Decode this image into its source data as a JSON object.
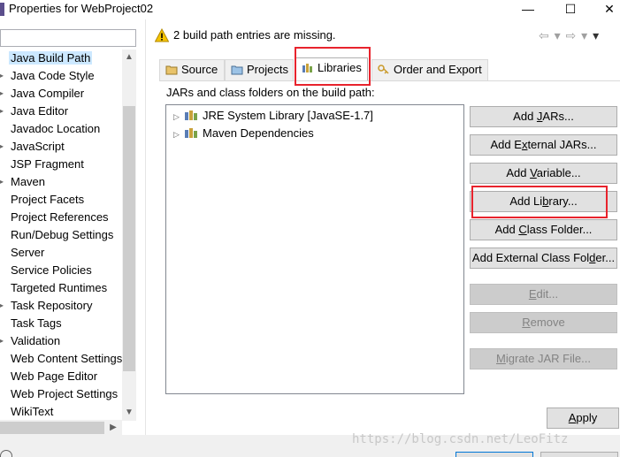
{
  "window": {
    "title": "Properties for WebProject02",
    "minimize_glyph": "—",
    "maximize_glyph": "☐",
    "close_glyph": "✕"
  },
  "left_panel": {
    "filter_placeholder": "",
    "items": [
      {
        "label": "Java Build Path",
        "selected": true
      },
      {
        "label": "Java Code Style",
        "expandable": true
      },
      {
        "label": "Java Compiler",
        "expandable": true
      },
      {
        "label": "Java Editor",
        "expandable": true
      },
      {
        "label": "Javadoc Location"
      },
      {
        "label": "JavaScript",
        "expandable": true
      },
      {
        "label": "JSP Fragment"
      },
      {
        "label": "Maven",
        "expandable": true
      },
      {
        "label": "Project Facets"
      },
      {
        "label": "Project References"
      },
      {
        "label": "Run/Debug Settings"
      },
      {
        "label": "Server"
      },
      {
        "label": "Service Policies"
      },
      {
        "label": "Targeted Runtimes"
      },
      {
        "label": "Task Repository",
        "expandable": true
      },
      {
        "label": "Task Tags"
      },
      {
        "label": "Validation",
        "expandable": true
      },
      {
        "label": "Web Content Settings"
      },
      {
        "label": "Web Page Editor"
      },
      {
        "label": "Web Project Settings"
      },
      {
        "label": "WikiText"
      }
    ]
  },
  "message": {
    "text": "2 build path entries are missing.",
    "icon": "warning-icon"
  },
  "tabs": [
    {
      "label": "Source",
      "icon": "source-folder-icon"
    },
    {
      "label": "Projects",
      "icon": "projects-icon"
    },
    {
      "label": "Libraries",
      "icon": "libraries-icon",
      "active": true
    },
    {
      "label": "Order and Export",
      "icon": "order-export-icon"
    }
  ],
  "libraries": {
    "label": "JARs and class folders on the build path:",
    "entries": [
      {
        "label": "JRE System Library [JavaSE-1.7]"
      },
      {
        "label": "Maven Dependencies"
      }
    ]
  },
  "buttons": {
    "add_jars": {
      "pre": "Add ",
      "u": "J",
      "post": "ARs..."
    },
    "add_external_jars": {
      "pre": "Add E",
      "u": "x",
      "post": "ternal JARs..."
    },
    "add_variable": {
      "pre": "Add ",
      "u": "V",
      "post": "ariable..."
    },
    "add_library": {
      "pre": "Add Li",
      "u": "b",
      "post": "rary..."
    },
    "add_class_folder": {
      "pre": "Add ",
      "u": "C",
      "post": "lass Folder..."
    },
    "add_external_class_folder": {
      "pre": "Add External Class Fol",
      "u": "d",
      "post": "er..."
    },
    "edit": {
      "pre": "",
      "u": "E",
      "post": "dit..."
    },
    "remove": {
      "pre": "",
      "u": "R",
      "post": "emove"
    },
    "migrate_jar": {
      "pre": "",
      "u": "M",
      "post": "igrate JAR File..."
    },
    "apply": {
      "pre": "",
      "u": "A",
      "post": "pply"
    }
  },
  "watermark": "https://blog.csdn.net/LeoFitz",
  "colors": {
    "highlight_red": "#e8232d",
    "selection": "#cce8ff",
    "button_face": "#e1e1e1"
  }
}
